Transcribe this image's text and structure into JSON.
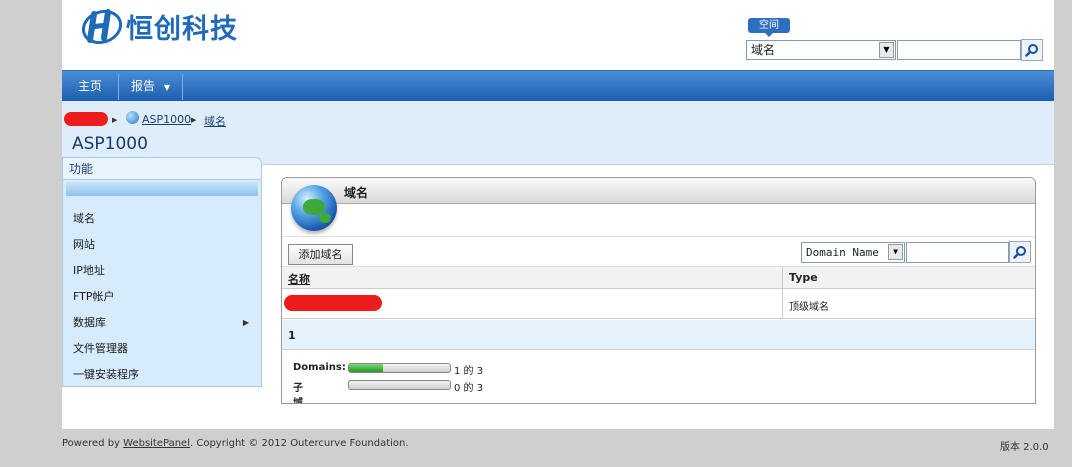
{
  "brand": {
    "name": "恒创科技",
    "accent": "#1f6ab9"
  },
  "search": {
    "badge": "空间",
    "scope": "域名",
    "value": "",
    "icon": "magnifier-icon"
  },
  "nav": {
    "items": [
      {
        "label": "主页"
      },
      {
        "label": "报告",
        "has_menu": true
      }
    ]
  },
  "breadcrumb": {
    "redacted_link": "",
    "items": [
      {
        "label": "ASP1000"
      },
      {
        "label": "域名"
      }
    ]
  },
  "page_title": "ASP1000",
  "sidebar": {
    "title": "功能",
    "items": [
      {
        "label": "域名"
      },
      {
        "label": "网站"
      },
      {
        "label": "IP地址"
      },
      {
        "label": "FTP帐户"
      },
      {
        "label": "数据库",
        "has_submenu": true
      },
      {
        "label": "文件管理器"
      },
      {
        "label": "一键安装程序"
      }
    ]
  },
  "panel": {
    "title": "域名",
    "add_button": "添加域名",
    "filter": {
      "field": "Domain Name",
      "value": ""
    },
    "columns": {
      "name": "名称",
      "type": "Type"
    },
    "rows": [
      {
        "name": "",
        "type": "顶级域名"
      }
    ],
    "pager": "1",
    "quotas": [
      {
        "label": "Domains:",
        "used": 1,
        "total": 3,
        "text": "1 的 3"
      },
      {
        "label": "子域名",
        "used": 0,
        "total": 3,
        "text": "0 的 3"
      }
    ]
  },
  "footer": {
    "powered_prefix": "Powered by ",
    "powered_link": "WebsitePanel",
    "copyright": ". Copyright © 2012 Outercurve Foundation.",
    "version": "版本 2.0.0"
  }
}
